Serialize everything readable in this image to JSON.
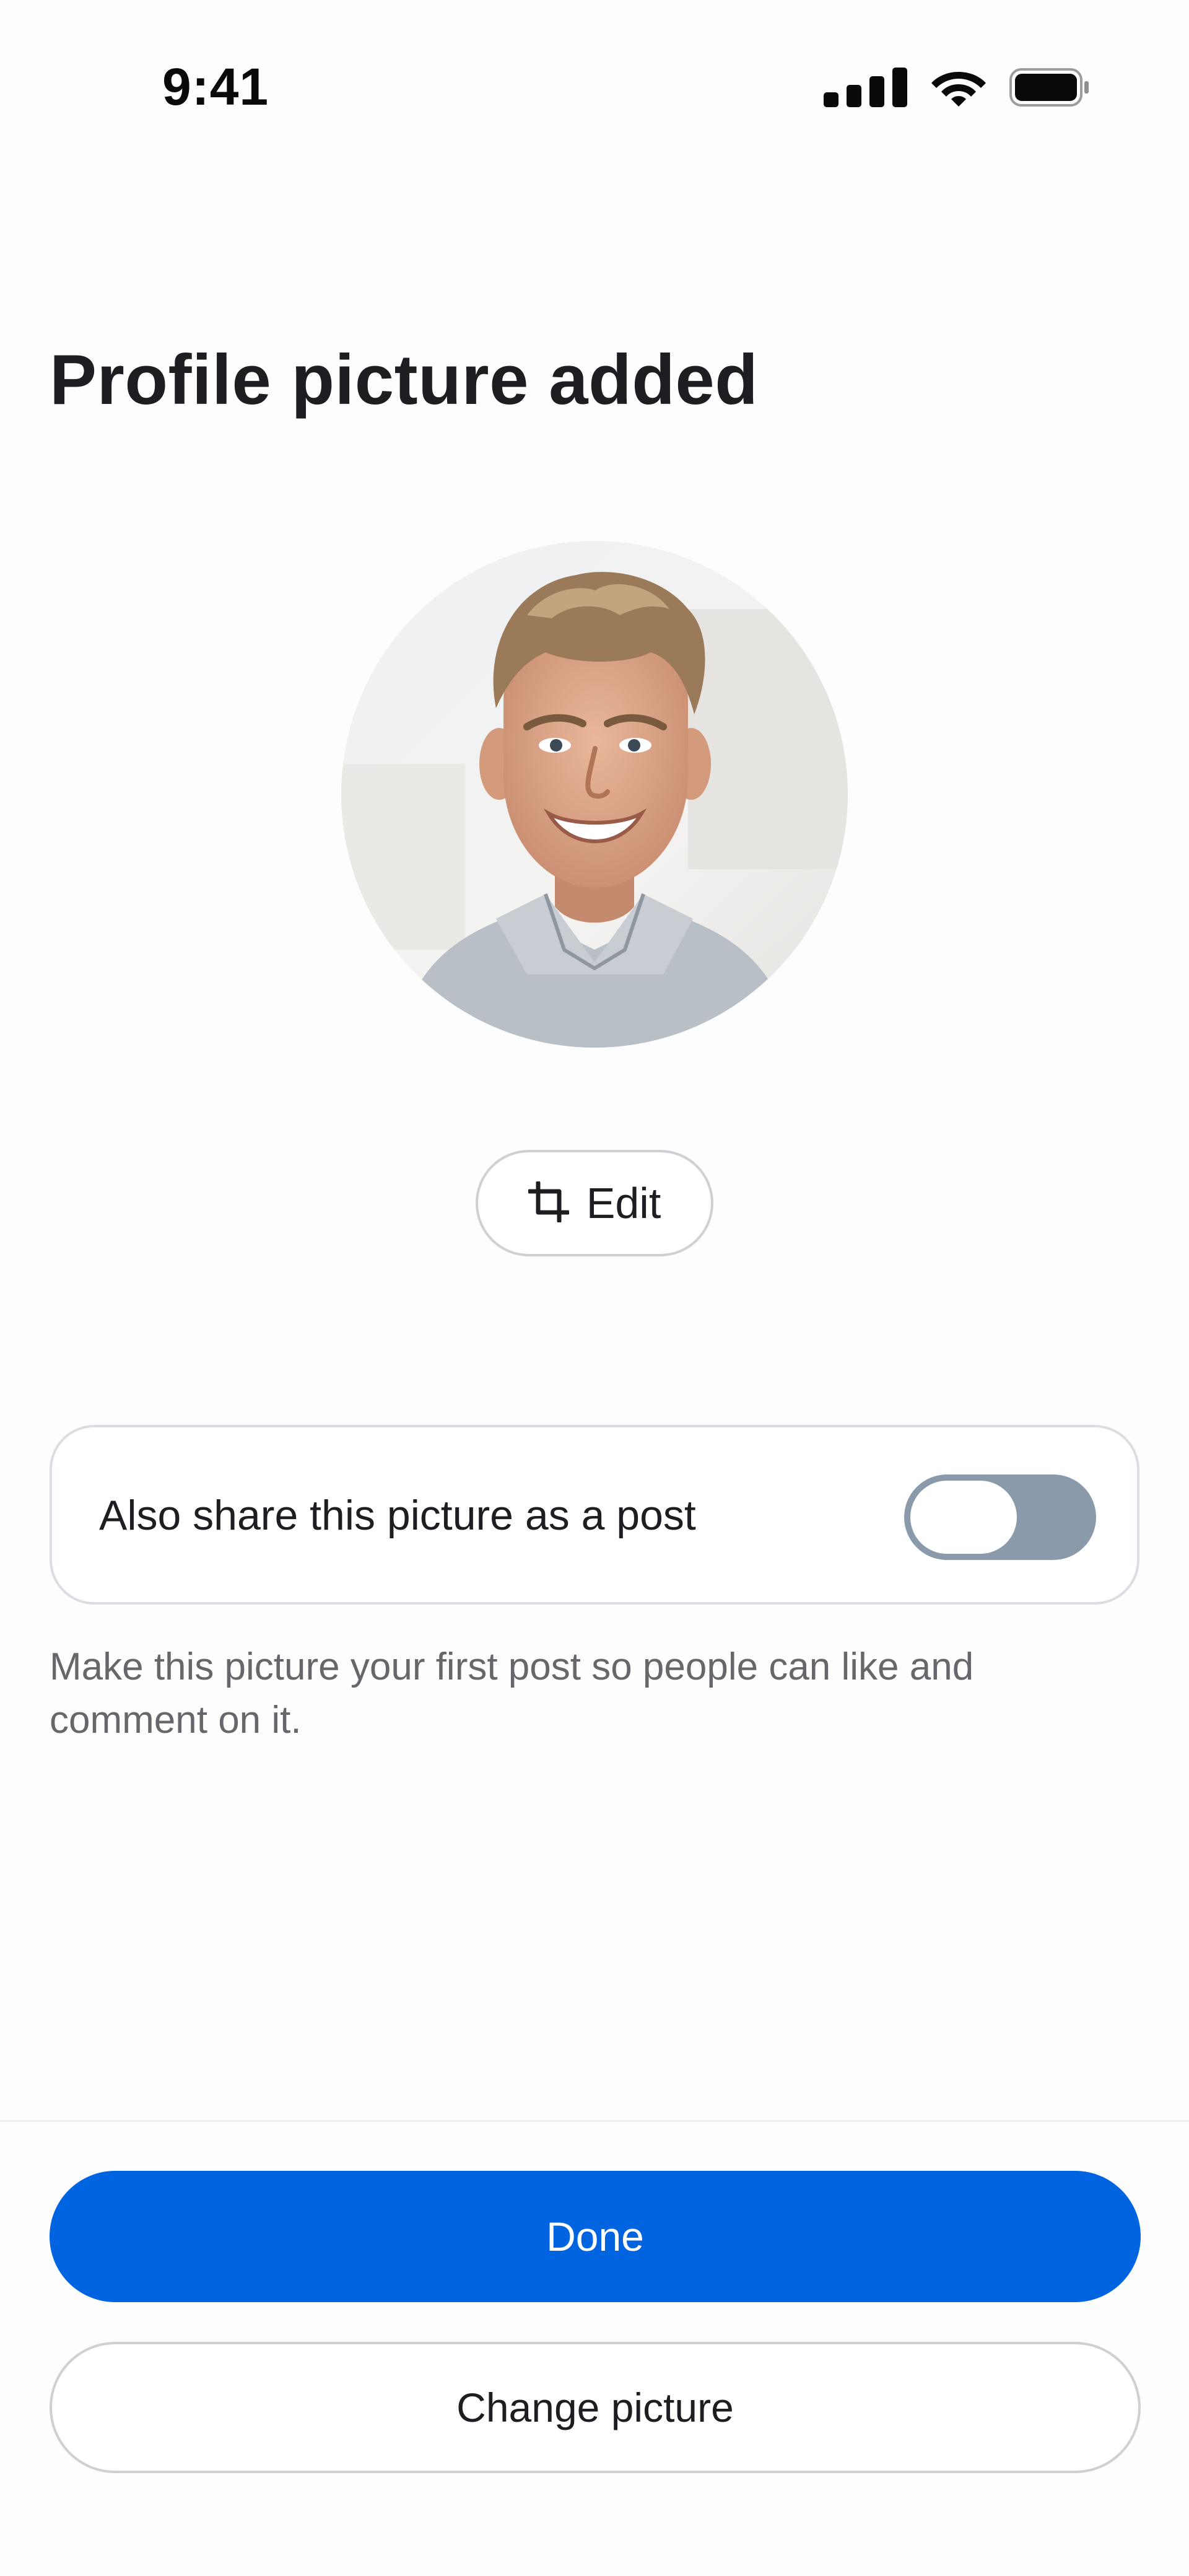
{
  "status_bar": {
    "time": "9:41",
    "icons": [
      "cellular-signal-icon",
      "wifi-icon",
      "battery-icon"
    ]
  },
  "header": {
    "title": "Profile picture added"
  },
  "avatar": {
    "icon": "profile-photo"
  },
  "edit_button": {
    "icon": "crop-icon",
    "label": "Edit"
  },
  "share_option": {
    "label": "Also share this picture as a post",
    "toggle_on": false,
    "helper_text": "Make this picture your first post so people can like and comment on it."
  },
  "actions": {
    "done_label": "Done",
    "change_label": "Change picture"
  },
  "colors": {
    "primary": "#0064e0",
    "toggle_off": "#8a9aab",
    "text_primary": "#1c1e21",
    "text_secondary": "#65676b",
    "border": "#ced0d4"
  }
}
